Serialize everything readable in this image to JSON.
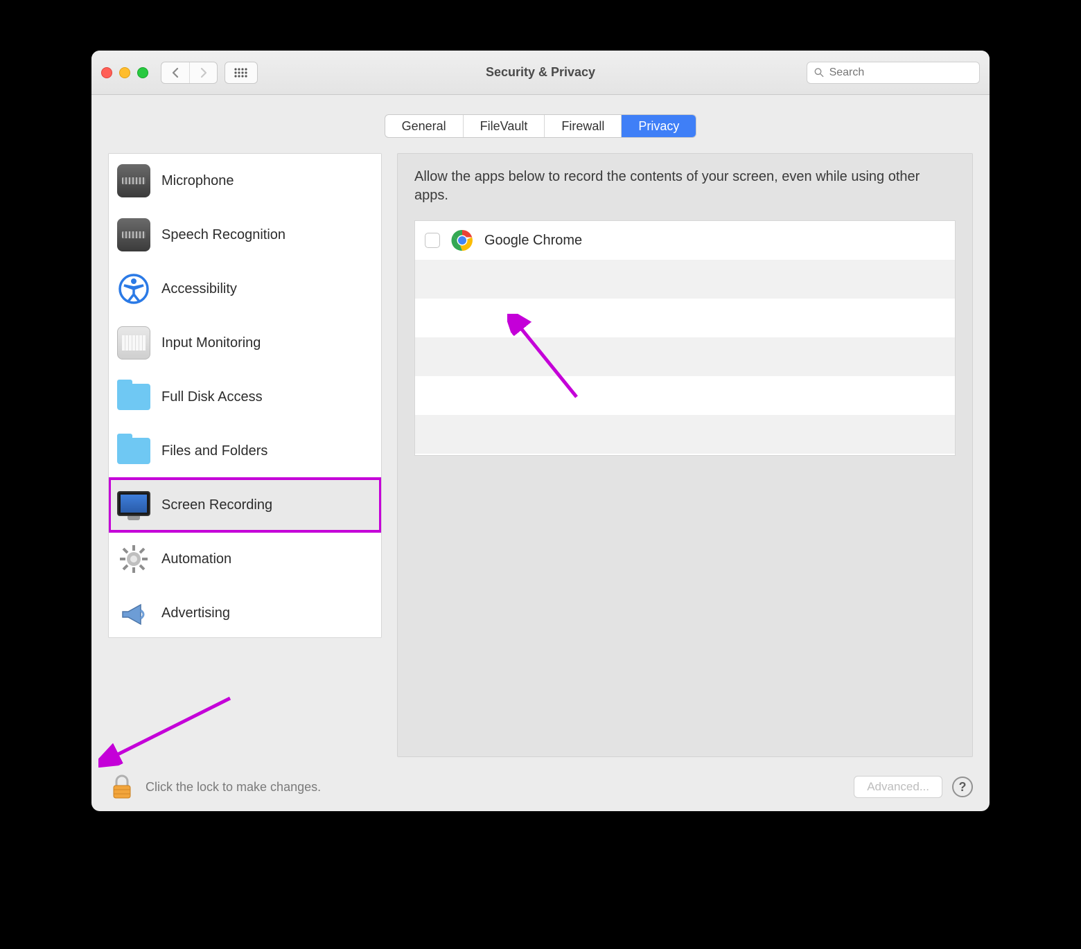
{
  "window": {
    "title": "Security & Privacy",
    "search_placeholder": "Search"
  },
  "tabs": {
    "items": [
      "General",
      "FileVault",
      "Firewall",
      "Privacy"
    ],
    "active_index": 3
  },
  "sidebar": {
    "items": [
      {
        "label": "Microphone",
        "icon": "microphone"
      },
      {
        "label": "Speech Recognition",
        "icon": "microphone"
      },
      {
        "label": "Accessibility",
        "icon": "accessibility"
      },
      {
        "label": "Input Monitoring",
        "icon": "keyboard"
      },
      {
        "label": "Full Disk Access",
        "icon": "folder"
      },
      {
        "label": "Files and Folders",
        "icon": "folder"
      },
      {
        "label": "Screen Recording",
        "icon": "screen",
        "selected": true
      },
      {
        "label": "Automation",
        "icon": "gear"
      },
      {
        "label": "Advertising",
        "icon": "megaphone"
      }
    ]
  },
  "main": {
    "description": "Allow the apps below to record the contents of your screen, even while using other apps.",
    "apps": [
      {
        "name": "Google Chrome",
        "checked": false
      }
    ]
  },
  "footer": {
    "lock_text": "Click the lock to make changes.",
    "advanced_label": "Advanced...",
    "help_label": "?"
  }
}
